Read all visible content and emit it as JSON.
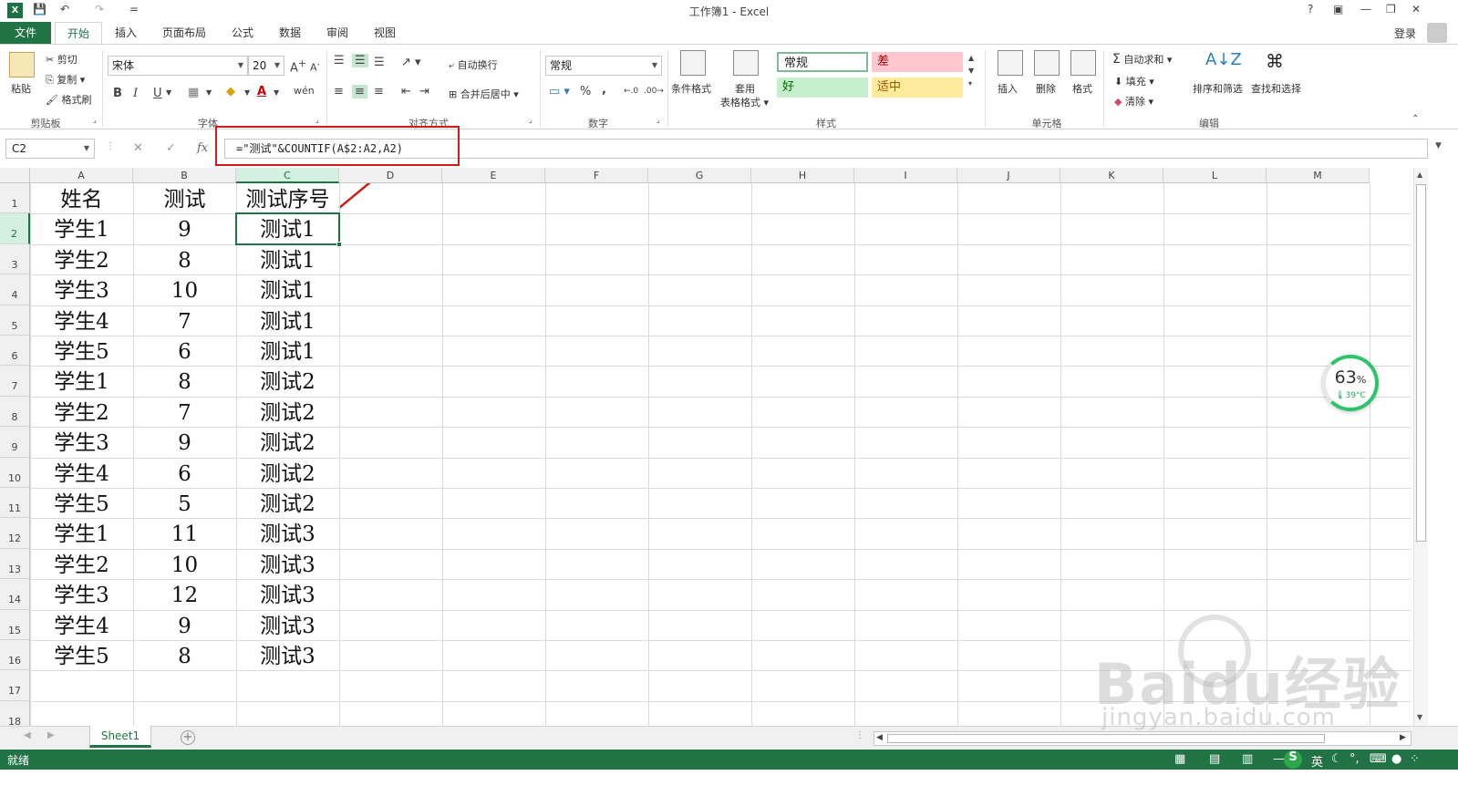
{
  "window": {
    "title": "工作簿1 - Excel",
    "help": "?",
    "controls": [
      "?",
      "▣",
      "—",
      "❐",
      "✕"
    ]
  },
  "quick_access": {
    "undo": "↶",
    "redo": "↷",
    "customize": "="
  },
  "tabs": [
    {
      "label": "文件",
      "kind": "file"
    },
    {
      "label": "开始",
      "kind": "active"
    },
    {
      "label": "插入"
    },
    {
      "label": "页面布局"
    },
    {
      "label": "公式"
    },
    {
      "label": "数据"
    },
    {
      "label": "审阅"
    },
    {
      "label": "视图"
    }
  ],
  "account": {
    "login_label": "登录"
  },
  "ribbon": {
    "clipboard": {
      "label": "剪贴板",
      "paste": "粘贴",
      "cut": "剪切",
      "copy": "复制",
      "format_painter": "格式刷"
    },
    "font": {
      "label": "字体",
      "font_name": "宋体",
      "font_size": "20",
      "bold": "B",
      "italic": "I",
      "underline": "U"
    },
    "alignment": {
      "label": "对齐方式",
      "wrap_text": "自动换行",
      "merge_center": "合并后居中"
    },
    "number": {
      "label": "数字",
      "format": "常规",
      "percent": "%",
      "comma": ","
    },
    "styles": {
      "label": "样式",
      "conditional": "条件格式",
      "table_format_1": "套用",
      "table_format_2": "表格格式",
      "normal": "常规",
      "bad": "差",
      "good": "好",
      "neutral": "适中",
      "colors": {
        "normal_bg": "#ffffff",
        "bad_bg": "#ffc7ce",
        "bad_fg": "#9c0006",
        "good_bg": "#c6efce",
        "good_fg": "#006100",
        "neutral_bg": "#ffeb9c",
        "neutral_fg": "#9c5700"
      }
    },
    "cells": {
      "label": "单元格",
      "insert": "插入",
      "delete": "删除",
      "format": "格式"
    },
    "editing": {
      "label": "编辑",
      "autosum": "自动求和",
      "fill": "填充",
      "clear": "清除",
      "sort_filter": "排序和筛选",
      "find_select": "查找和选择"
    }
  },
  "formula_bar": {
    "name_box": "C2",
    "cancel": "✕",
    "enter": "✓",
    "fx": "fx",
    "formula": "=\"测试\"&COUNTIF(A$2:A2,A2)"
  },
  "grid": {
    "columns": [
      "A",
      "B",
      "C",
      "D",
      "E",
      "F",
      "G",
      "H",
      "I",
      "J",
      "K",
      "L",
      "M"
    ],
    "rows": [
      "1",
      "2",
      "3",
      "4",
      "5",
      "6",
      "7",
      "8",
      "9",
      "10",
      "11",
      "12",
      "13",
      "14",
      "15",
      "16",
      "17",
      "18"
    ],
    "header": [
      "姓名",
      "测试",
      "测试序号"
    ],
    "data": [
      [
        "学生1",
        "9",
        "测试1"
      ],
      [
        "学生2",
        "8",
        "测试1"
      ],
      [
        "学生3",
        "10",
        "测试1"
      ],
      [
        "学生4",
        "7",
        "测试1"
      ],
      [
        "学生5",
        "6",
        "测试1"
      ],
      [
        "学生1",
        "8",
        "测试2"
      ],
      [
        "学生2",
        "7",
        "测试2"
      ],
      [
        "学生3",
        "9",
        "测试2"
      ],
      [
        "学生4",
        "6",
        "测试2"
      ],
      [
        "学生5",
        "5",
        "测试2"
      ],
      [
        "学生1",
        "11",
        "测试3"
      ],
      [
        "学生2",
        "10",
        "测试3"
      ],
      [
        "学生3",
        "12",
        "测试3"
      ],
      [
        "学生4",
        "9",
        "测试3"
      ],
      [
        "学生5",
        "8",
        "测试3"
      ]
    ],
    "selected_cell": "C2"
  },
  "sheets": [
    {
      "name": "Sheet1"
    }
  ],
  "status": {
    "ready": "就绪"
  },
  "overlay": {
    "cpu_percent": "63",
    "percent_sign": "%",
    "temp": "39°C"
  },
  "watermark": {
    "brand": "Baidu经验",
    "url": "jingyan.baidu.com"
  },
  "theme": {
    "accent": "#217346",
    "annotation": "#d01b1b"
  }
}
